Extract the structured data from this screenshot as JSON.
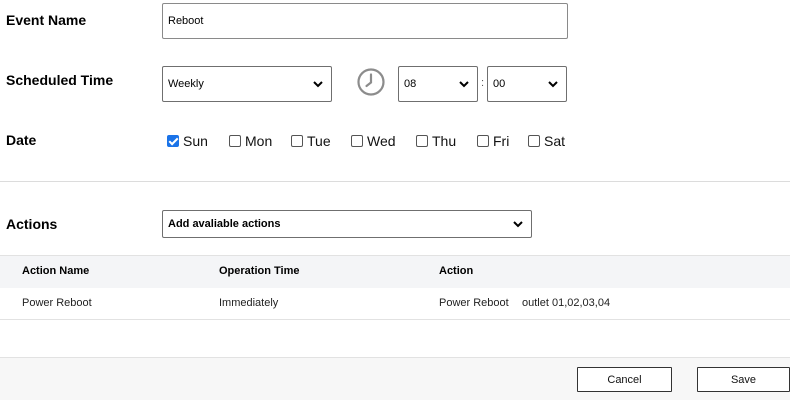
{
  "form": {
    "event_name_label": "Event Name",
    "event_name_value": "Reboot",
    "scheduled_time_label": "Scheduled Time",
    "frequency_value": "Weekly",
    "hour_value": "08",
    "time_separator": ":",
    "minute_value": "00",
    "date_label": "Date",
    "days": [
      {
        "label": "Sun",
        "checked": true
      },
      {
        "label": "Mon",
        "checked": false
      },
      {
        "label": "Tue",
        "checked": false
      },
      {
        "label": "Wed",
        "checked": false
      },
      {
        "label": "Thu",
        "checked": false
      },
      {
        "label": "Fri",
        "checked": false
      },
      {
        "label": "Sat",
        "checked": false
      }
    ]
  },
  "actions": {
    "label": "Actions",
    "select_value": "Add avaliable actions",
    "columns": [
      "Action Name",
      "Operation Time",
      "Action"
    ],
    "rows": [
      {
        "name": "Power Reboot",
        "time": "Immediately",
        "action": "Power Reboot",
        "target": "outlet 01,02,03,04"
      }
    ]
  },
  "footer": {
    "cancel_label": "Cancel",
    "save_label": "Save"
  },
  "icons": {
    "clock": "clock-icon",
    "chevron": "chevron-down-icon",
    "check": "check-icon"
  },
  "colors": {
    "accent": "#1a73e8",
    "table_header_bg": "#f4f5f7",
    "footer_bg": "#f7f7f7"
  }
}
